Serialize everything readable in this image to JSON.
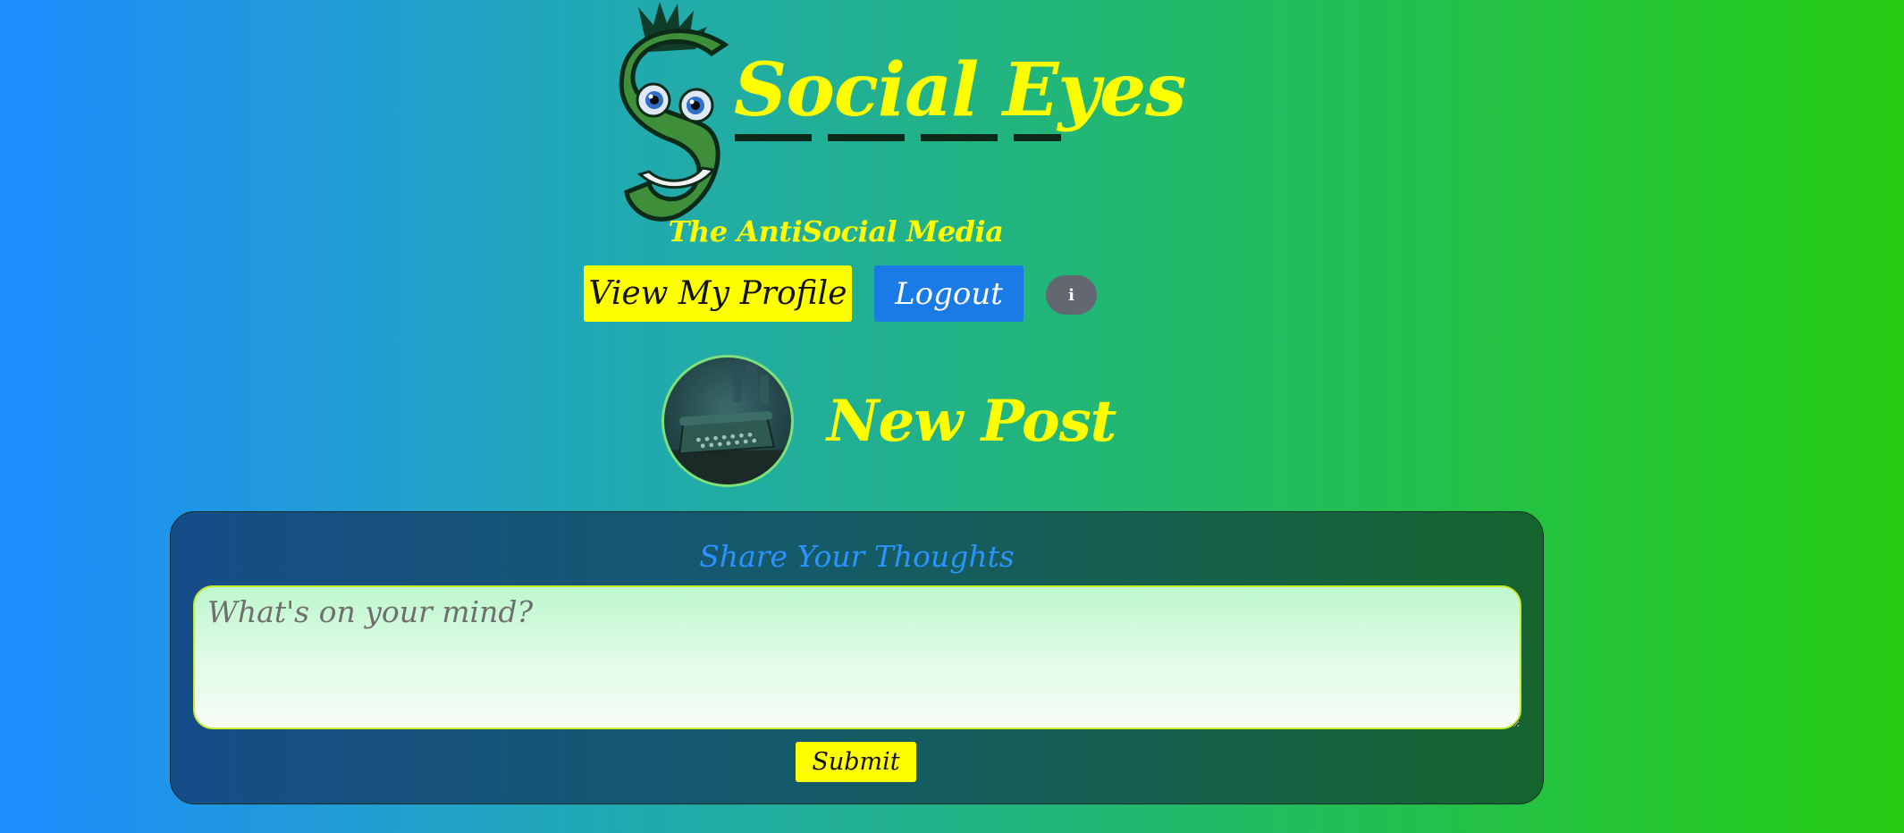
{
  "brand": {
    "title": "Social Eyes",
    "tagline": "The AntiSocial Media"
  },
  "nav": {
    "profile_label": "View My Profile",
    "logout_label": "Logout",
    "info_label": "i"
  },
  "new_post": {
    "title": "New Post",
    "avatar_icon": "typewriter-icon"
  },
  "post_form": {
    "heading": "Share Your Thoughts",
    "textarea_value": "",
    "textarea_placeholder": "What's on your mind?",
    "submit_label": "Submit"
  },
  "colors": {
    "accent_yellow": "#ffff00",
    "logout_blue": "#1a7be6",
    "heading_blue": "#2b93ff",
    "info_gray": "#636870"
  }
}
